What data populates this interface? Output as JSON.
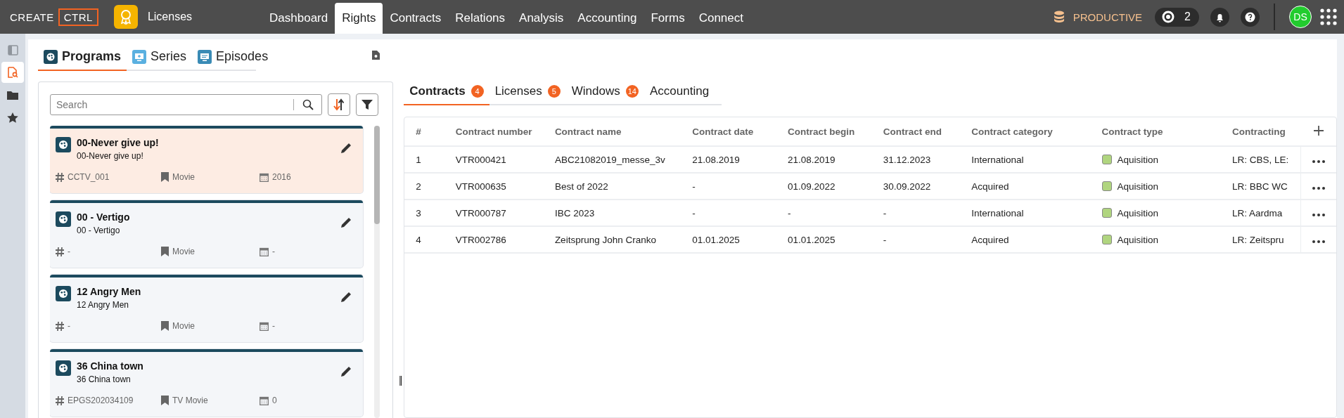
{
  "header": {
    "logo": {
      "left": "CREATE",
      "right": "CTRL"
    },
    "app_name": "Licenses",
    "nav": [
      {
        "label": "Dashboard",
        "selected": false
      },
      {
        "label": "Rights",
        "selected": true
      },
      {
        "label": "Contracts",
        "selected": false
      },
      {
        "label": "Relations",
        "selected": false
      },
      {
        "label": "Analysis",
        "selected": false
      },
      {
        "label": "Accounting",
        "selected": false
      },
      {
        "label": "Forms",
        "selected": false
      },
      {
        "label": "Connect",
        "selected": false
      }
    ],
    "environment": "PRODUCTIVE",
    "notifications_count": "2",
    "user_initials": "DS"
  },
  "rail": [
    {
      "kind": "panel",
      "selected": false
    },
    {
      "kind": "search-doc",
      "selected": true
    },
    {
      "kind": "folder",
      "selected": false
    },
    {
      "kind": "star",
      "selected": false
    }
  ],
  "left_tabs": [
    {
      "label": "Programs",
      "kind": "program",
      "selected": true
    },
    {
      "label": "Series",
      "kind": "series",
      "selected": false
    },
    {
      "label": "Episodes",
      "kind": "episode",
      "selected": false
    }
  ],
  "search": {
    "placeholder": "Search"
  },
  "programs": [
    {
      "title": "00-Never give up!",
      "subtitle": "00-Never give up!",
      "code": "CCTV_001",
      "genre": "Movie",
      "year": "2016",
      "selected": true
    },
    {
      "title": "00 - Vertigo",
      "subtitle": "00 - Vertigo",
      "code": "-",
      "genre": "Movie",
      "year": "-",
      "selected": false
    },
    {
      "title": "12 Angry Men",
      "subtitle": "12 Angry Men",
      "code": "-",
      "genre": "Movie",
      "year": "-",
      "selected": false
    },
    {
      "title": "36 China town",
      "subtitle": "36 China town",
      "code": "EPGS202034109",
      "genre": "TV Movie",
      "year": "0",
      "selected": false
    }
  ],
  "right_tabs": [
    {
      "label": "Contracts",
      "badge": "4",
      "selected": true
    },
    {
      "label": "Licenses",
      "badge": "5",
      "selected": false
    },
    {
      "label": "Windows",
      "badge": "14",
      "selected": false
    },
    {
      "label": "Accounting",
      "selected": false
    }
  ],
  "table": {
    "columns": [
      "#",
      "Contract number",
      "Contract name",
      "Contract date",
      "Contract begin",
      "Contract end",
      "Contract category",
      "Contract type",
      "Contracting"
    ],
    "rows": [
      {
        "index": "1",
        "number": "VTR000421",
        "name": "ABC21082019_messe_3v",
        "date": "21.08.2019",
        "begin": "21.08.2019",
        "end": "31.12.2023",
        "category": "International",
        "type": "Aquisition",
        "color": "#b0d57f",
        "contracting": "LR: CBS, LE:"
      },
      {
        "index": "2",
        "number": "VTR000635",
        "name": "Best of 2022",
        "date": "-",
        "begin": "01.09.2022",
        "end": "30.09.2022",
        "category": "Acquired",
        "type": "Aquisition",
        "color": "#b0d57f",
        "contracting": "LR: BBC WC"
      },
      {
        "index": "3",
        "number": "VTR000787",
        "name": "IBC 2023",
        "date": "-",
        "begin": "-",
        "end": "-",
        "category": "International",
        "type": "Aquisition",
        "color": "#b0d57f",
        "contracting": "LR: Aardma"
      },
      {
        "index": "4",
        "number": "VTR002786",
        "name": "Zeitsprung John Cranko",
        "date": "01.01.2025",
        "begin": "01.01.2025",
        "end": "-",
        "category": "Acquired",
        "type": "Aquisition",
        "color": "#b0d57f",
        "contracting": "LR: Zeitspru"
      }
    ]
  },
  "splitter": "||"
}
